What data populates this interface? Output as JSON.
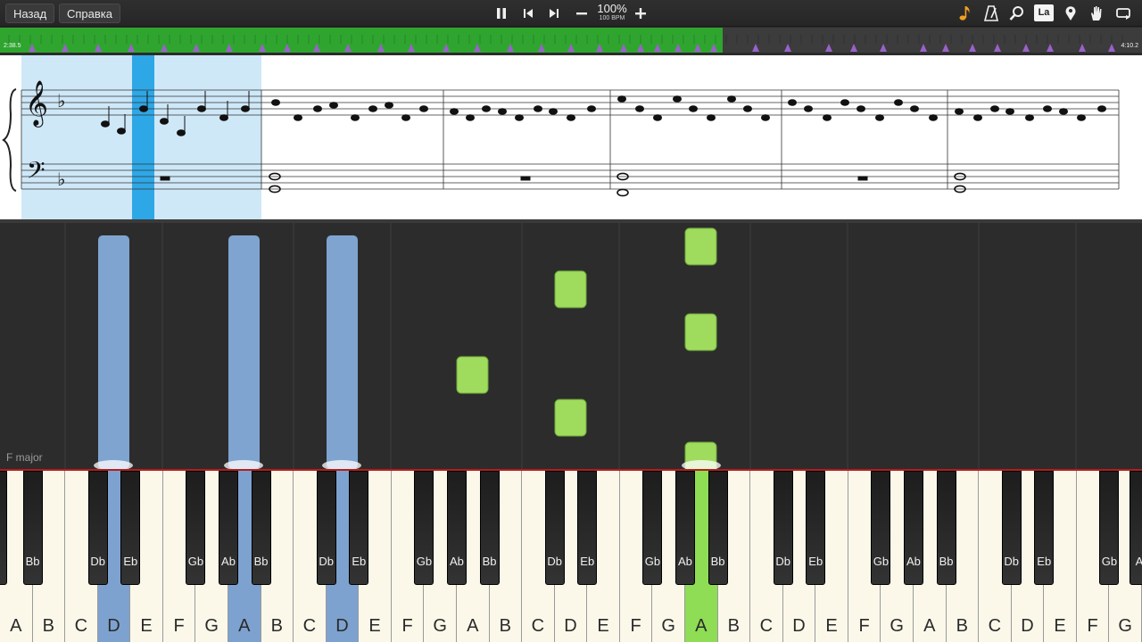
{
  "toolbar": {
    "back_label": "Назад",
    "help_label": "Справка",
    "tempo_percent": "100%",
    "tempo_bpm": "100 BPM",
    "lyrics_label": "La"
  },
  "timeline": {
    "time_left": "2:38.5",
    "time_right": "4:10.2",
    "progress": 0.633
  },
  "status": {
    "key_signature": "F major"
  },
  "colors": {
    "played": "#2fa52f",
    "left_hand_note": "#7fa4d0",
    "right_hand_note": "#9fdc5e",
    "keyboard_divider": "#b71c1c"
  },
  "icons": [
    "pause-icon",
    "skip-back-icon",
    "skip-forward-icon",
    "minus-icon",
    "plus-icon",
    "note-icon",
    "metronome-icon",
    "magnifier-icon",
    "marker-icon",
    "hand-icon",
    "loop-icon"
  ],
  "keyboard": {
    "white_keys": [
      "A",
      "B",
      "C",
      "D",
      "E",
      "F",
      "G",
      "A",
      "B",
      "C",
      "D",
      "E",
      "F",
      "G",
      "A",
      "B",
      "C",
      "D",
      "E",
      "F",
      "G",
      "A",
      "B",
      "C",
      "D",
      "E",
      "F",
      "G",
      "A",
      "B",
      "C",
      "D",
      "E",
      "F",
      "G"
    ],
    "black_keys": [
      "Bb",
      "Db",
      "Eb",
      "Gb",
      "Ab",
      "Bb",
      "Db",
      "Eb",
      "Gb",
      "Ab",
      "Bb",
      "Db",
      "Eb",
      "Gb",
      "Ab",
      "Bb",
      "Db",
      "Eb",
      "Gb",
      "Ab",
      "Bb",
      "Db",
      "Eb",
      "Gb",
      "Ab"
    ],
    "first_black_partial": "b",
    "last_black_partial": "A"
  }
}
